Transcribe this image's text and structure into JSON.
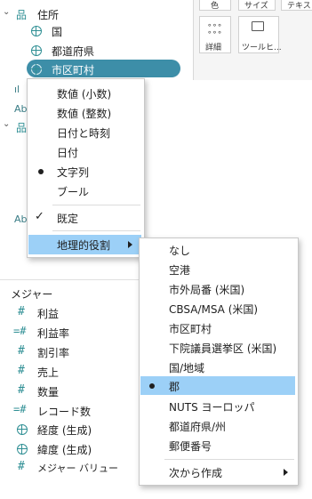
{
  "tree": {
    "folder": "住所",
    "items": [
      "国",
      "都道府県",
      "市区町村"
    ]
  },
  "hidden_glyphs": {
    "bars": "ıl",
    "abc1": "Ab",
    "abc2": "Ab",
    "abc3": "Ab"
  },
  "marks": {
    "btn1": "色",
    "btn2": "サイズ",
    "btn3": "テキスト",
    "detail": "詳細",
    "tooltip": "ツールヒ..."
  },
  "type_menu": {
    "items": [
      "数値 (小数)",
      "数値 (整数)",
      "日付と時刻",
      "日付",
      "文字列",
      "ブール"
    ],
    "default": "既定",
    "geo": "地理的役割"
  },
  "geo_menu": {
    "items": [
      "なし",
      "空港",
      "市外局番 (米国)",
      "CBSA/MSA (米国)",
      "市区町村",
      "下院議員選挙区 (米国)",
      "国/地域",
      "郡",
      "NUTS ヨーロッパ",
      "都道府県/州",
      "郵便番号"
    ],
    "create_from": "次から作成"
  },
  "measures": {
    "header": "メジャー",
    "items": [
      "利益",
      "利益率",
      "割引率",
      "売上",
      "数量",
      "レコード数",
      "経度 (生成)",
      "緯度 (生成)",
      "メジャー バリュー"
    ]
  }
}
